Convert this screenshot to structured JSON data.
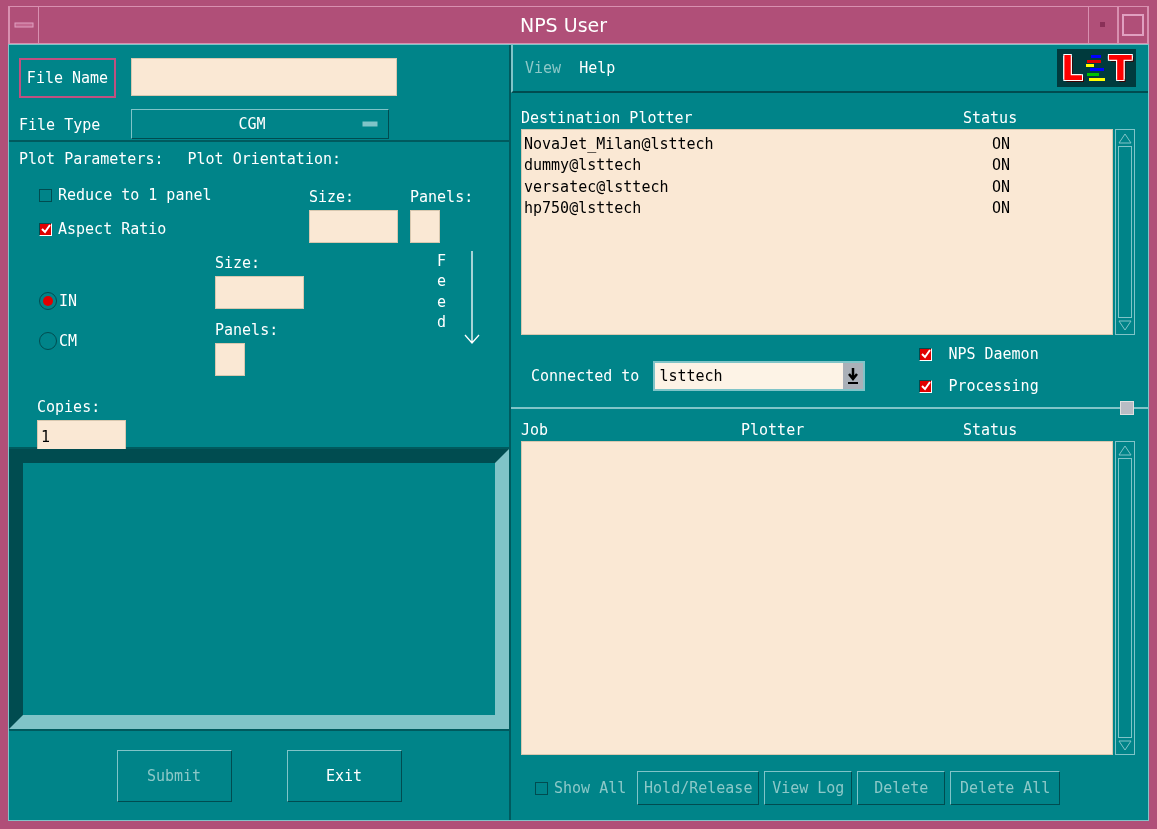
{
  "window": {
    "title": "NPS User"
  },
  "file_name": {
    "label": "File Name"
  },
  "file_type": {
    "label": "File Type",
    "value": "CGM"
  },
  "plot": {
    "parameters_label": "Plot Parameters:",
    "orientation_label": "Plot Orientation:",
    "options": [
      {
        "label": "Reduce to 1 panel",
        "checked": false
      },
      {
        "label": "Aspect Ratio",
        "checked": true
      }
    ],
    "units": [
      {
        "label": "IN",
        "selected": true
      },
      {
        "label": "CM",
        "selected": false
      }
    ],
    "size_label": "Size:",
    "panels_label": "Panels:",
    "orientation_size_label": "Size:",
    "orientation_panels_label": "Panels:",
    "feed_label": "Feed",
    "copies": {
      "label": "Copies:",
      "value": "1"
    }
  },
  "actions": [
    {
      "label": "Submit",
      "disabled": true
    },
    {
      "label": "Exit",
      "disabled": false
    }
  ],
  "menu": [
    {
      "label": "View",
      "disabled": true
    },
    {
      "label": "Help",
      "disabled": false
    }
  ],
  "logo": {
    "left": "L",
    "right": "T"
  },
  "plotters": {
    "columns": [
      "Destination Plotter",
      "Status"
    ],
    "rows": [
      {
        "name": "NovaJet_Milan@lsttech",
        "status": "ON"
      },
      {
        "name": "dummy@lsttech",
        "status": "ON"
      },
      {
        "name": "versatec@lsttech",
        "status": "ON"
      },
      {
        "name": "hp750@lsttech",
        "status": "ON"
      }
    ]
  },
  "connection": {
    "label": "Connected to",
    "value": "lsttech"
  },
  "daemon_flags": [
    {
      "label": "NPS Daemon",
      "checked": true
    },
    {
      "label": "Processing",
      "checked": true
    }
  ],
  "jobs": {
    "columns": [
      "Job",
      "Plotter",
      "Status"
    ]
  },
  "show_all": {
    "label": "Show All",
    "checked": false,
    "disabled": true
  },
  "job_buttons": [
    {
      "label": "Hold/Release",
      "disabled": true
    },
    {
      "label": "View Log",
      "disabled": true
    },
    {
      "label": "Delete",
      "disabled": true
    },
    {
      "label": "Delete All",
      "disabled": true
    }
  ]
}
